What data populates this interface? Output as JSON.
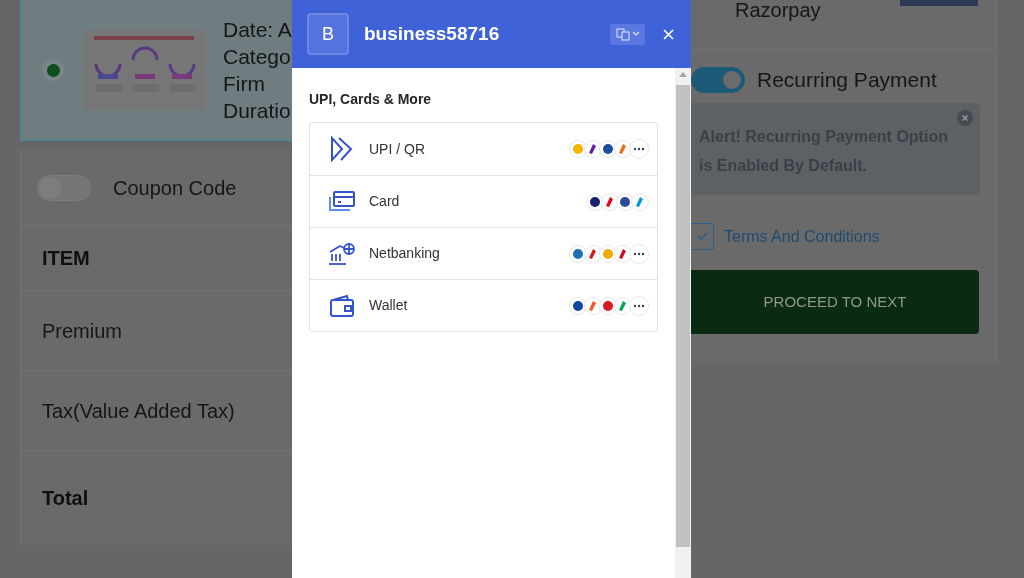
{
  "order_card": {
    "selected": true,
    "details": [
      "Date: A",
      "Catego",
      "Firm",
      "Duratio"
    ]
  },
  "coupon": {
    "label": "Coupon Code",
    "on": false
  },
  "summary_rows": [
    {
      "kind": "header",
      "label": "ITEM"
    },
    {
      "kind": "item",
      "label": "Premium"
    },
    {
      "kind": "item",
      "label": "Tax(Value Added Tax)"
    },
    {
      "kind": "total",
      "label": "Total"
    }
  ],
  "gateway": {
    "name": "Razorpay"
  },
  "recurring": {
    "label": "Recurring Payment",
    "on": true
  },
  "alert": {
    "text": "Alert! Recurring Payment Option is Enabled By Default."
  },
  "terms": {
    "label": "Terms And Conditions",
    "checked": true
  },
  "proceed_button": "PROCEED TO NEXT",
  "checkout": {
    "avatar": "B",
    "merchant": "business58716",
    "section_title": "UPI, Cards & More",
    "methods": [
      {
        "kind": "upi",
        "label": "UPI / QR",
        "more": true
      },
      {
        "kind": "card",
        "label": "Card",
        "more": false
      },
      {
        "kind": "netbanking",
        "label": "Netbanking",
        "more": true
      },
      {
        "kind": "wallet",
        "label": "Wallet",
        "more": true
      }
    ]
  }
}
